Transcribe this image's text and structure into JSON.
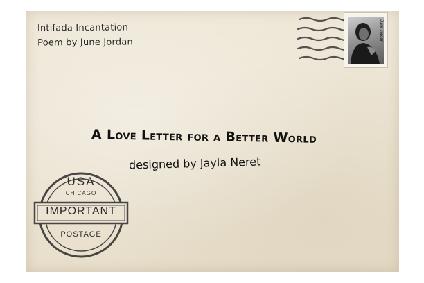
{
  "return_address": {
    "line1": "Intifada Incantation",
    "line2": "Poem by June Jordan"
  },
  "main": {
    "title": "A Love Letter for a Better World",
    "designer": "designed by Jayla Neret"
  },
  "stamp": {
    "name": "June Jordan"
  },
  "seal": {
    "country": "USA",
    "city": "CHICAGO",
    "label": "IMPORTANT",
    "footer": "POSTAGE"
  },
  "colors": {
    "envelope": "#ece5d4",
    "ink": "#2b2b2b"
  }
}
